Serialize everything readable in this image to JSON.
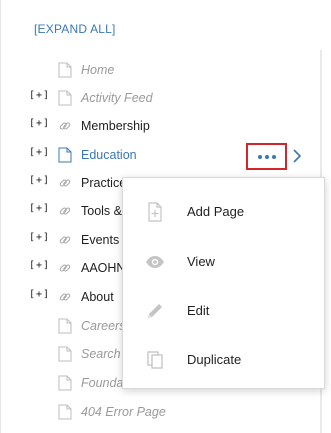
{
  "header": {
    "expand_all": "[EXPAND ALL]"
  },
  "tree": {
    "toggle_label": "[+]",
    "items": [
      {
        "label": "Home",
        "style": "muted",
        "toggle": false,
        "icon": "page-icon"
      },
      {
        "label": "Activity Feed",
        "style": "muted",
        "toggle": true,
        "icon": "page-icon"
      },
      {
        "label": "Membership",
        "style": "dark",
        "toggle": true,
        "icon": "link-icon"
      },
      {
        "label": "Education",
        "style": "link",
        "toggle": true,
        "icon": "page-icon"
      },
      {
        "label": "Practice",
        "style": "dark",
        "toggle": true,
        "icon": "link-icon"
      },
      {
        "label": "Tools &",
        "style": "dark",
        "toggle": true,
        "icon": "link-icon"
      },
      {
        "label": "Events",
        "style": "dark",
        "toggle": true,
        "icon": "link-icon"
      },
      {
        "label": "AAOHN",
        "style": "dark",
        "toggle": true,
        "icon": "link-icon"
      },
      {
        "label": "About",
        "style": "dark",
        "toggle": true,
        "icon": "link-icon"
      },
      {
        "label": "Careers",
        "style": "muted",
        "toggle": false,
        "icon": "page-icon"
      },
      {
        "label": "Search",
        "style": "muted",
        "toggle": false,
        "icon": "page-icon"
      },
      {
        "label": "Founda",
        "style": "muted",
        "toggle": false,
        "icon": "page-icon"
      },
      {
        "label": "404 Error Page",
        "style": "muted",
        "toggle": false,
        "icon": "page-icon"
      }
    ]
  },
  "context_menu": {
    "items": [
      {
        "label": "Add Page",
        "icon": "add-page-icon"
      },
      {
        "label": "View",
        "icon": "eye-icon"
      },
      {
        "label": "Edit",
        "icon": "pencil-icon"
      },
      {
        "label": "Duplicate",
        "icon": "duplicate-icon"
      }
    ]
  },
  "colors": {
    "accent": "#3a78b5",
    "highlight_border": "#d2262b",
    "muted_text": "#9a9a9a",
    "icon_gray": "#bdbdbd"
  }
}
